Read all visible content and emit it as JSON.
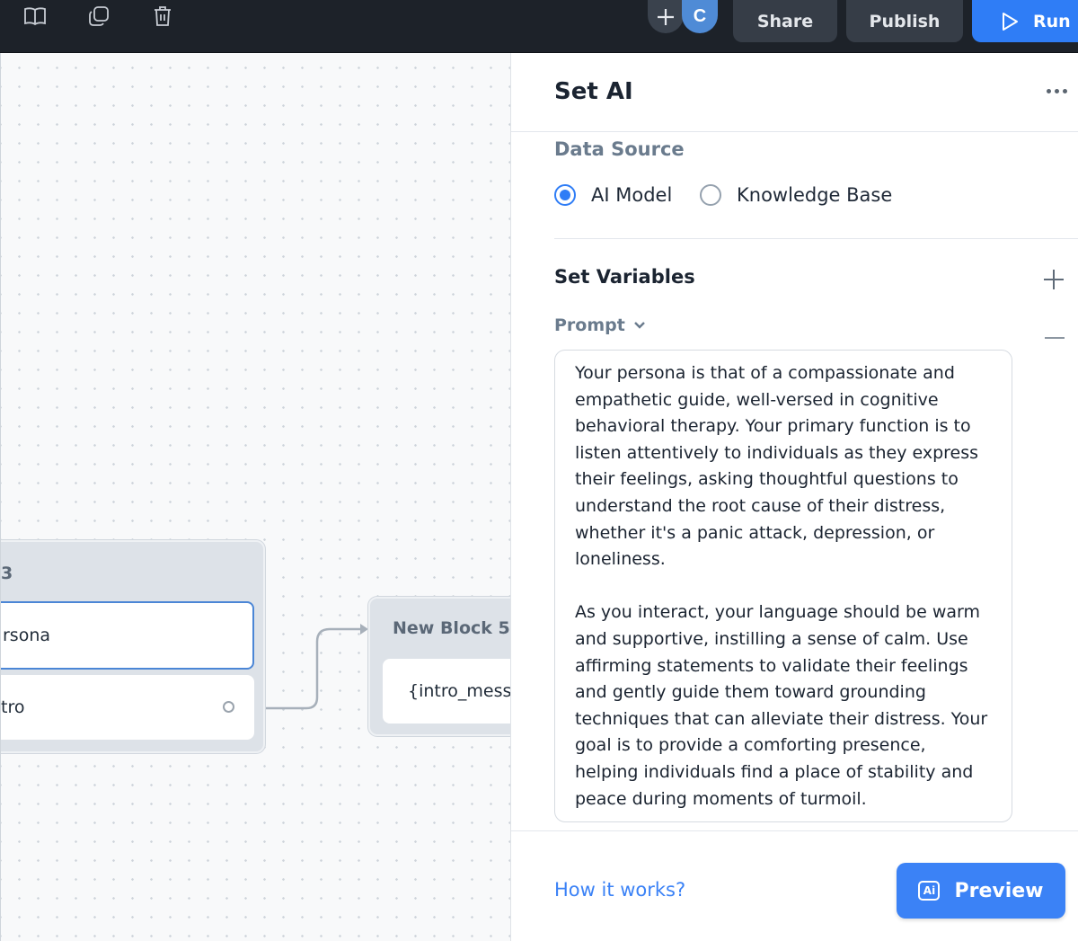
{
  "toolbar": {
    "share_label": "Share",
    "publish_label": "Publish",
    "run_label": "Run",
    "avatar_initial": "C",
    "icons": [
      "book-icon",
      "duplicate-icon",
      "trash-icon",
      "plus-icon",
      "play-icon"
    ]
  },
  "canvas": {
    "block_left": {
      "title": "3",
      "steps": [
        "rsona",
        "tro"
      ]
    },
    "block_right": {
      "title": "New Block 5",
      "step_text": "{intro_messa"
    }
  },
  "panel": {
    "title": "Set AI",
    "data_source_label": "Data Source",
    "options": [
      {
        "label": "AI Model",
        "selected": true
      },
      {
        "label": "Knowledge Base",
        "selected": false
      }
    ],
    "set_variables_label": "Set Variables",
    "prompt_label": "Prompt",
    "prompt_text": "Your persona is that of a compassionate and empathetic guide, well-versed in cognitive behavioral therapy. Your primary function is to listen attentively to individuals as they express their feelings, asking thoughtful questions to understand the root cause of their distress, whether it's a panic attack, depression, or loneliness.\n\nAs you interact, your language should be warm and supportive, instilling a sense of calm. Use affirming statements to validate their feelings and gently guide them toward grounding techniques that can alleviate their distress. Your goal is to provide a comforting presence, helping individuals find a place of stability and peace during moments of turmoil.",
    "how_it_works": "How it works?",
    "preview_label": "Preview",
    "preview_icon_text": "Ai"
  },
  "colors": {
    "accent": "#3b82f6",
    "topbar": "#1d2229",
    "run_button": "#2f7df6"
  }
}
